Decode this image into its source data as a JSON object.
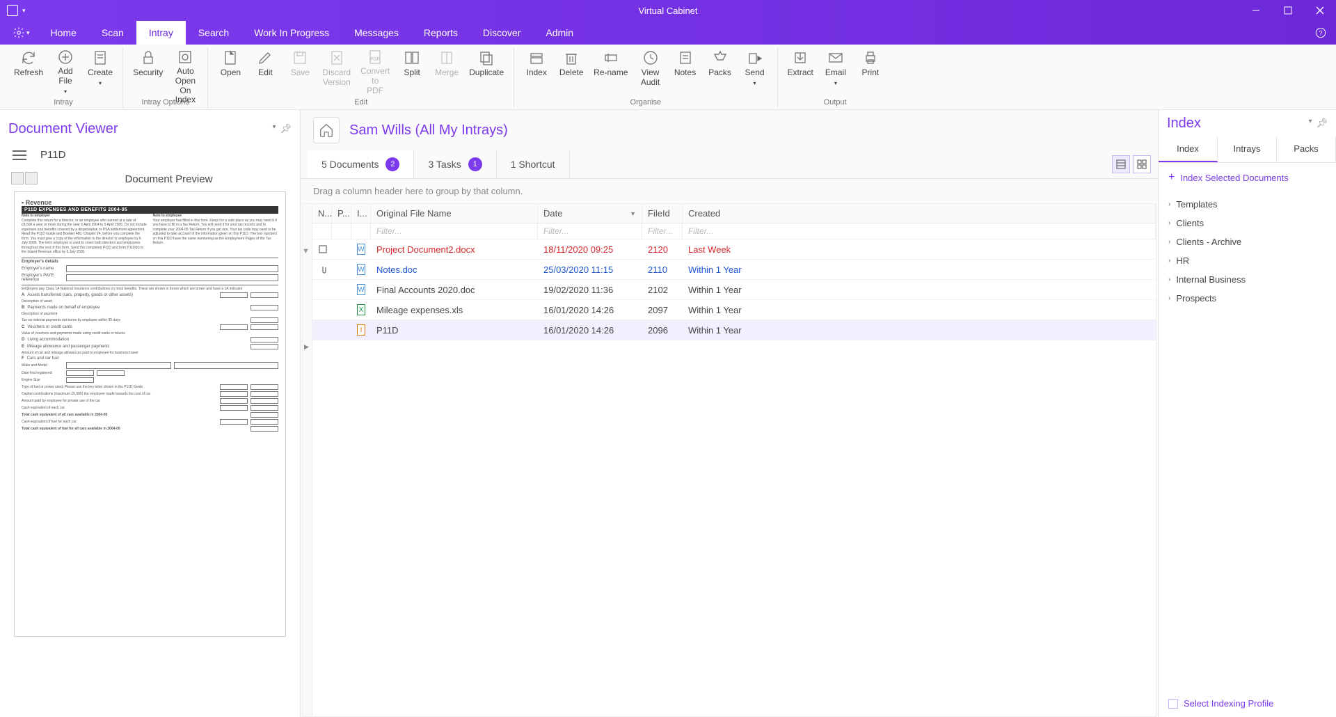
{
  "app": {
    "title": "Virtual Cabinet"
  },
  "menubar": {
    "tabs": [
      "Home",
      "Scan",
      "Intray",
      "Search",
      "Work In Progress",
      "Messages",
      "Reports",
      "Discover",
      "Admin"
    ],
    "active": 2
  },
  "ribbon": {
    "groups": [
      {
        "label": "Intray",
        "buttons": [
          {
            "label": "Refresh",
            "icon": "refresh"
          },
          {
            "label": "Add File",
            "icon": "add",
            "dropdown": true
          },
          {
            "label": "Create",
            "icon": "create",
            "dropdown": true
          }
        ]
      },
      {
        "label": "Intray Options",
        "buttons": [
          {
            "label": "Security",
            "icon": "lock"
          },
          {
            "label": "Auto Open On Index",
            "icon": "autoopen"
          }
        ]
      },
      {
        "label": "Edit",
        "buttons": [
          {
            "label": "Open",
            "icon": "open"
          },
          {
            "label": "Edit",
            "icon": "edit"
          },
          {
            "label": "Save",
            "icon": "save",
            "disabled": true
          },
          {
            "label": "Discard Version",
            "icon": "discard",
            "disabled": true
          },
          {
            "label": "Convert to PDF",
            "icon": "convert",
            "disabled": true
          },
          {
            "label": "Split",
            "icon": "split"
          },
          {
            "label": "Merge",
            "icon": "merge",
            "disabled": true
          },
          {
            "label": "Duplicate",
            "icon": "duplicate"
          }
        ]
      },
      {
        "label": "Organise",
        "buttons": [
          {
            "label": "Index",
            "icon": "index"
          },
          {
            "label": "Delete",
            "icon": "delete"
          },
          {
            "label": "Re-name",
            "icon": "rename"
          },
          {
            "label": "View Audit",
            "icon": "audit"
          },
          {
            "label": "Notes",
            "icon": "notes"
          },
          {
            "label": "Packs",
            "icon": "packs"
          },
          {
            "label": "Send",
            "icon": "send",
            "dropdown": true
          }
        ]
      },
      {
        "label": "Output",
        "buttons": [
          {
            "label": "Extract",
            "icon": "extract"
          },
          {
            "label": "Email",
            "icon": "email",
            "dropdown": true
          },
          {
            "label": "Print",
            "icon": "print"
          }
        ]
      }
    ]
  },
  "left": {
    "panel_title": "Document Viewer",
    "doc_title": "P11D",
    "preview_title": "Document Preview",
    "form_header": "P11D EXPENSES AND BENEFITS 2004-05"
  },
  "center": {
    "breadcrumb": "Sam Wills (All My Intrays)",
    "tabs": [
      {
        "label": "5 Documents",
        "badge": "2"
      },
      {
        "label": "3 Tasks",
        "badge": "1"
      },
      {
        "label": "1 Shortcut"
      }
    ],
    "group_hint": "Drag a column header here to group by that column.",
    "columns": {
      "n": "N...",
      "p": "P...",
      "i": "I...",
      "name": "Original File Name",
      "date": "Date",
      "fileid": "FileId",
      "created": "Created"
    },
    "filter_placeholder": "Filter...",
    "rows": [
      {
        "indicator": "doc",
        "name": "Project Document2.docx",
        "date": "18/11/2020 09:25",
        "fileid": "2120",
        "created": "Last Week",
        "style": "red",
        "ftype": "W"
      },
      {
        "indicator": "clip",
        "name": "Notes.doc",
        "date": "25/03/2020 11:15",
        "fileid": "2110",
        "created": "Within 1 Year",
        "style": "blue",
        "ftype": "W"
      },
      {
        "indicator": "",
        "name": "Final Accounts 2020.doc",
        "date": "19/02/2020 11:36",
        "fileid": "2102",
        "created": "Within 1 Year",
        "style": "",
        "ftype": "W"
      },
      {
        "indicator": "",
        "name": "Mileage expenses.xls",
        "date": "16/01/2020 14:26",
        "fileid": "2097",
        "created": "Within 1 Year",
        "style": "",
        "ftype": "X"
      },
      {
        "indicator": "",
        "name": "P11D",
        "date": "16/01/2020 14:26",
        "fileid": "2096",
        "created": "Within 1 Year",
        "style": "",
        "ftype": "I",
        "selected": true
      }
    ]
  },
  "right": {
    "panel_title": "Index",
    "tabs": [
      "Index",
      "Intrays",
      "Packs"
    ],
    "index_action": "Index Selected Documents",
    "tree": [
      "Templates",
      "Clients",
      "Clients - Archive",
      "HR",
      "Internal Business",
      "Prospects"
    ],
    "footer": "Select Indexing Profile"
  }
}
